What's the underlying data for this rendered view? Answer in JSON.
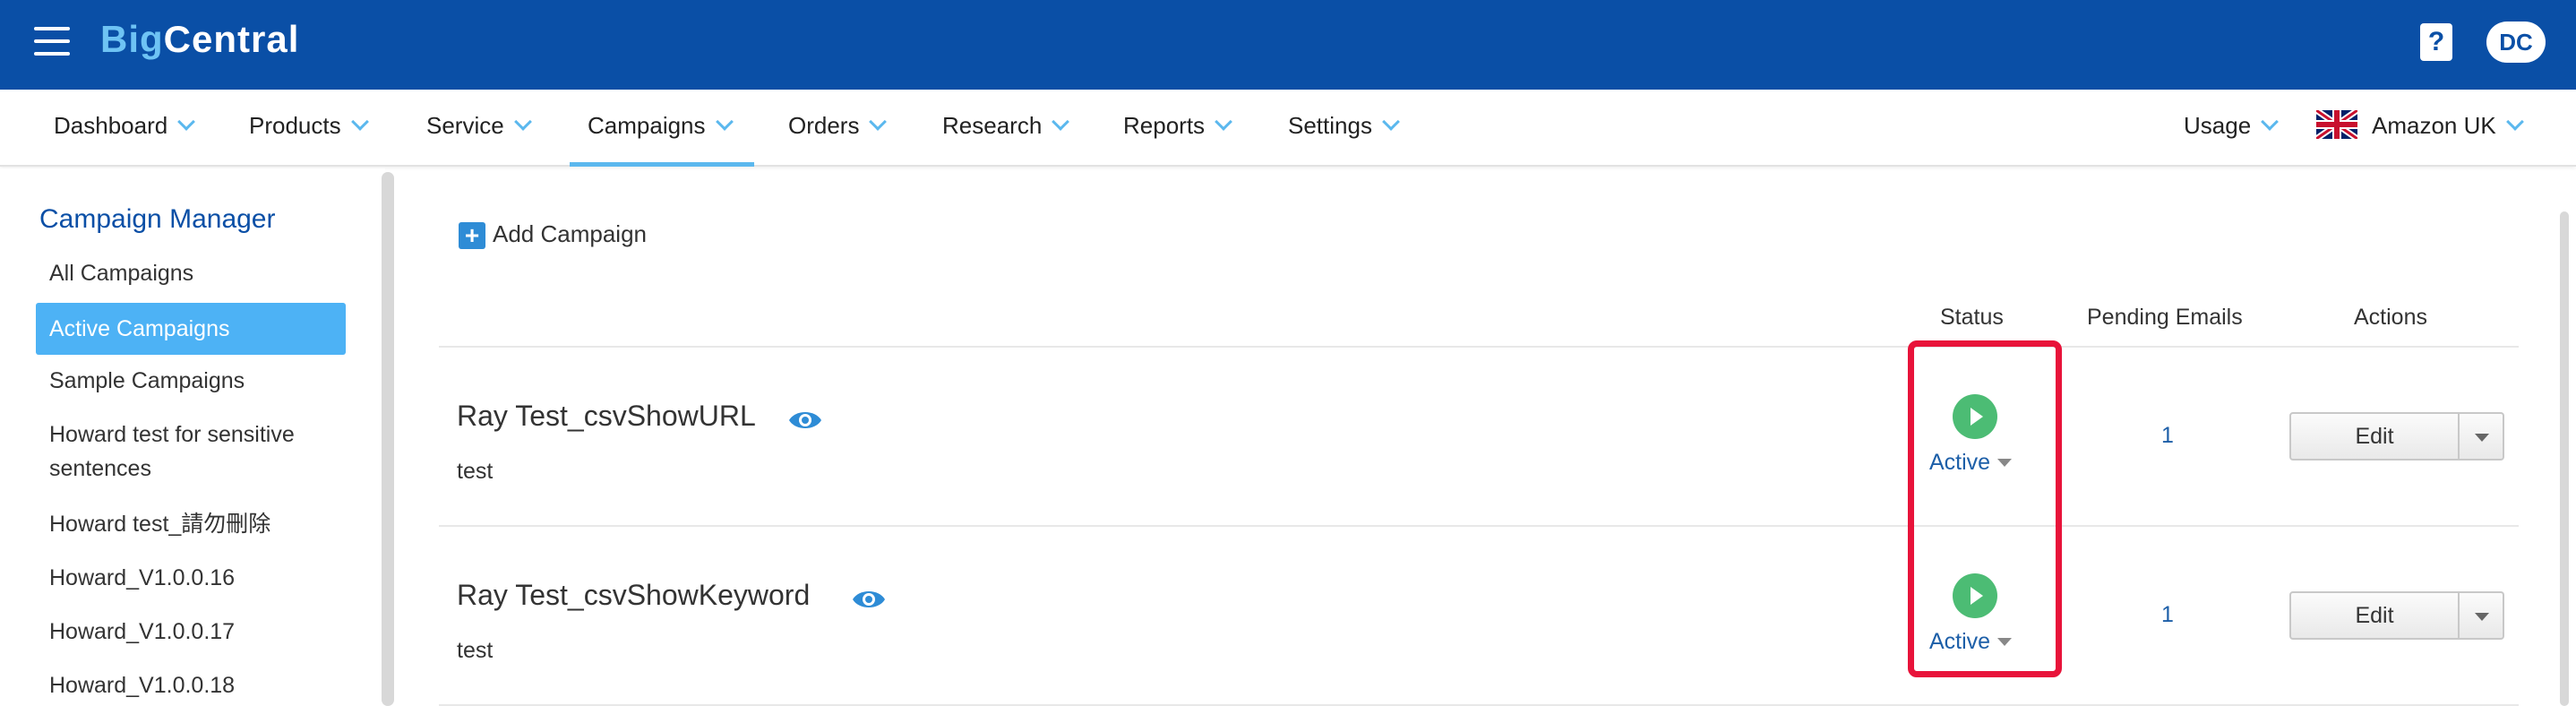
{
  "app": {
    "logo_part1": "Big",
    "logo_part2": "Central",
    "help_icon": "?",
    "user_initials": "DC"
  },
  "nav": {
    "items": [
      {
        "label": "Dashboard"
      },
      {
        "label": "Products"
      },
      {
        "label": "Service"
      },
      {
        "label": "Campaigns"
      },
      {
        "label": "Orders"
      },
      {
        "label": "Research"
      },
      {
        "label": "Reports"
      },
      {
        "label": "Settings"
      }
    ],
    "active_index": 3,
    "usage_label": "Usage",
    "marketplace_label": "Amazon UK"
  },
  "sidebar": {
    "title": "Campaign Manager",
    "items": [
      {
        "label": "All Campaigns"
      },
      {
        "label": "Active Campaigns"
      },
      {
        "label": "Sample Campaigns"
      },
      {
        "label": "Howard test for sensitive sentences"
      },
      {
        "label": "Howard test_請勿刪除"
      },
      {
        "label": "Howard_V1.0.0.16"
      },
      {
        "label": "Howard_V1.0.0.17"
      },
      {
        "label": "Howard_V1.0.0.18"
      }
    ],
    "active_index": 1
  },
  "main": {
    "add_campaign_label": "Add Campaign",
    "columns": {
      "status": "Status",
      "pending": "Pending Emails",
      "actions": "Actions"
    },
    "rows": [
      {
        "name": "Ray Test_csvShowURL",
        "description": "test",
        "status": "Active",
        "pending_emails": "1",
        "action_label": "Edit"
      },
      {
        "name": "Ray Test_csvShowKeyword",
        "description": "test",
        "status": "Active",
        "pending_emails": "1",
        "action_label": "Edit"
      }
    ]
  },
  "colors": {
    "topbar": "#0a4fa6",
    "accent": "#5bb8ee",
    "active_sidebar": "#4db2f5",
    "status_green": "#4cbc74",
    "highlight_red": "#e8133a"
  }
}
